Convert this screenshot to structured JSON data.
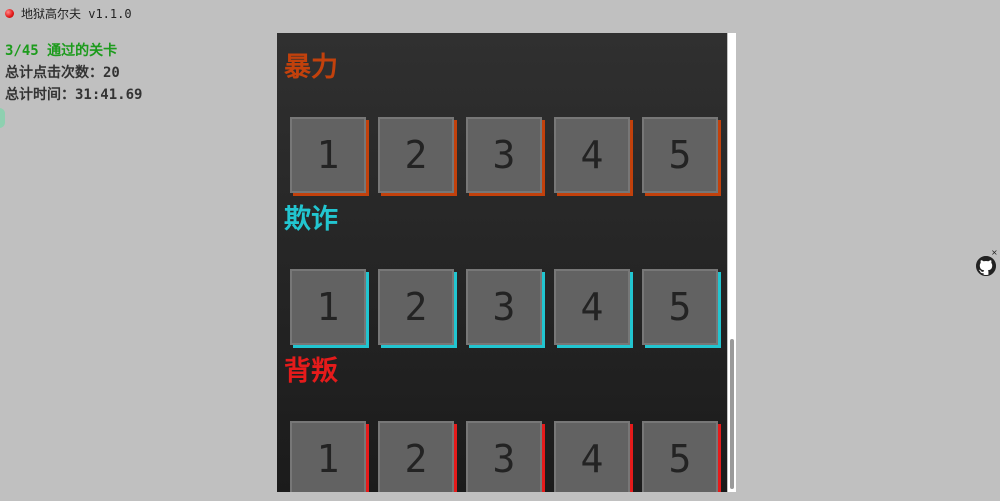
{
  "window": {
    "title": "地狱高尔夫 v1.1.0"
  },
  "stats": {
    "progress": "3/45",
    "progress_label": "通过的关卡",
    "total_clicks_label": "总计点击次数：",
    "total_clicks_value": "20",
    "total_time_label": "总计时间：",
    "total_time_value": "31:41.69"
  },
  "categories": [
    {
      "name": "暴力",
      "color": "#c2410c",
      "levels": [
        "1",
        "2",
        "3",
        "4",
        "5"
      ]
    },
    {
      "name": "欺诈",
      "color": "#22c5d0",
      "levels": [
        "1",
        "2",
        "3",
        "4",
        "5"
      ]
    },
    {
      "name": "背叛",
      "color": "#e51b1b",
      "levels": [
        "1",
        "2",
        "3",
        "4",
        "5"
      ]
    }
  ],
  "widget": {
    "close_label": "×",
    "icon": "github-icon"
  }
}
